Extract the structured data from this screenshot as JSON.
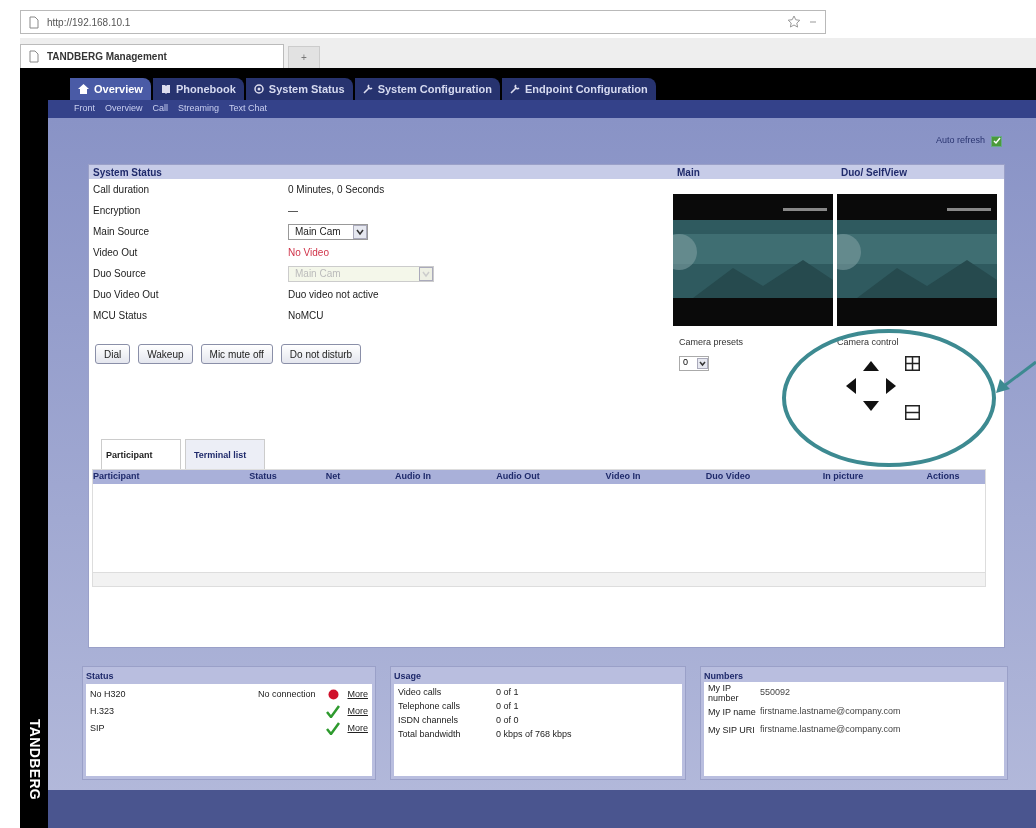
{
  "browser": {
    "url": "http://192.168.10.1",
    "tab_title": "TANDBERG Management",
    "new_tab": "+"
  },
  "brand": "TANDBERG",
  "nav_tabs": [
    {
      "label": "Overview",
      "kind": "home",
      "selected": true
    },
    {
      "label": "Phonebook",
      "kind": "book",
      "selected": false
    },
    {
      "label": "System Status",
      "kind": "status",
      "selected": false
    },
    {
      "label": "System Configuration",
      "kind": "config",
      "selected": false
    },
    {
      "label": "Endpoint Configuration",
      "kind": "config",
      "selected": false
    }
  ],
  "sub_nav": [
    "Front",
    "Overview",
    "Call",
    "Streaming",
    "Text Chat"
  ],
  "auto_refresh": {
    "label": "Auto refresh",
    "checked": true
  },
  "system_status": {
    "title": "System Status",
    "rows": [
      {
        "kind": "text",
        "label": "Call duration",
        "value": "0 Minutes, 0 Seconds"
      },
      {
        "kind": "text",
        "label": "Encryption",
        "value": "—"
      },
      {
        "kind": "select",
        "label": "Main Source",
        "value": "Main Cam",
        "disabled": false
      },
      {
        "kind": "alert",
        "label": "Video Out",
        "value": "No Video"
      },
      {
        "kind": "select",
        "label": "Duo Source",
        "value": "Main Cam",
        "disabled": true
      },
      {
        "kind": "text",
        "label": "Duo Video Out",
        "value": "Duo video not active"
      },
      {
        "kind": "text",
        "label": "MCU Status",
        "value": "NoMCU"
      }
    ],
    "buttons": [
      "Dial",
      "Wakeup",
      "Mic mute off",
      "Do not disturb"
    ]
  },
  "video": {
    "main_title": "Main",
    "duo_title": "Duo/ SelfView"
  },
  "camera_presets": {
    "label": "Camera presets",
    "value": "0"
  },
  "camera_control": {
    "label": "Camera control"
  },
  "participants": {
    "tabs": [
      {
        "label": "Participant",
        "selected": true
      },
      {
        "label": "Terminal list",
        "selected": false
      }
    ],
    "columns": [
      "Participant",
      "Status",
      "Net",
      "Audio In",
      "Audio Out",
      "Video In",
      "Duo Video",
      "In picture",
      "Actions"
    ]
  },
  "status": {
    "title": "Status",
    "rows": [
      {
        "label": "No H320",
        "message": "No connection",
        "connected": false,
        "link": "More"
      },
      {
        "label": "H.323",
        "connected": true,
        "link": "More"
      },
      {
        "label": "SIP",
        "connected": true,
        "link": "More"
      }
    ]
  },
  "usage": {
    "title": "Usage",
    "rows": [
      {
        "label": "Video calls",
        "value": "0 of 1"
      },
      {
        "label": "Telephone calls",
        "value": "0 of 1"
      },
      {
        "label": "ISDN channels",
        "value": "0 of 0"
      },
      {
        "label": "Total bandwidth",
        "value": "0 kbps of 768 kbps"
      }
    ]
  },
  "numbers": {
    "title": "Numbers",
    "rows": [
      {
        "label": "My IP number",
        "value": "550092"
      },
      {
        "label": "My IP name",
        "value": "firstname.lastname@company.com"
      },
      {
        "label": "My SIP URI",
        "value": "firstname.lastname@company.com"
      }
    ]
  }
}
